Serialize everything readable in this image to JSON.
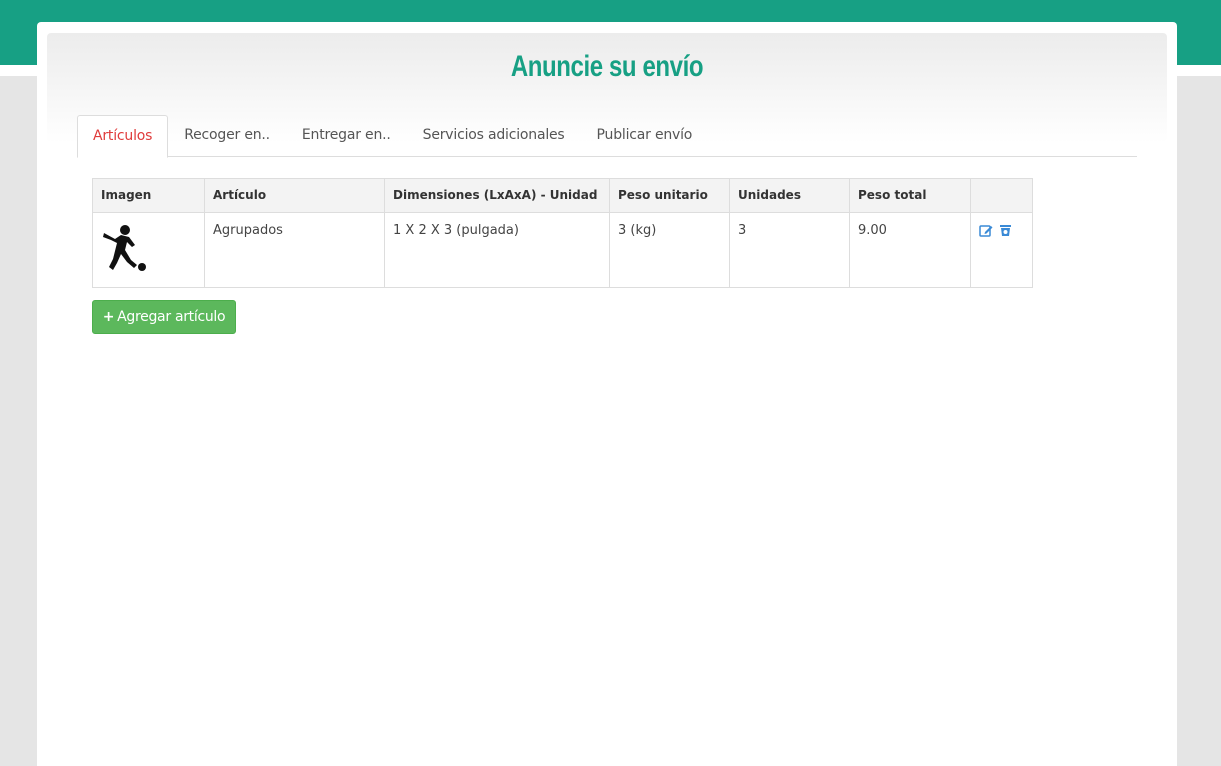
{
  "page": {
    "title": "Anuncie su envío"
  },
  "tabs": [
    {
      "label": "Artículos",
      "active": true
    },
    {
      "label": "Recoger en..",
      "active": false
    },
    {
      "label": "Entregar en..",
      "active": false
    },
    {
      "label": "Servicios adicionales",
      "active": false
    },
    {
      "label": "Publicar envío",
      "active": false
    }
  ],
  "table": {
    "headers": [
      "Imagen",
      "Artículo",
      "Dimensiones (LxAxA) - Unidad",
      "Peso unitario",
      "Unidades",
      "Peso total",
      ""
    ],
    "rows": [
      {
        "image_icon": "soccer-player-icon",
        "article": "Agrupados",
        "dimensions": "1 X 2 X 3 (pulgada)",
        "unit_weight": "3 (kg)",
        "units": "3",
        "total_weight": "9.00",
        "actions": [
          "edit-icon",
          "delete-icon"
        ]
      }
    ]
  },
  "buttons": {
    "add_item_icon": "+",
    "add_item": "Agregar artículo"
  },
  "colors": {
    "brand": "#17a084",
    "active_tab": "#e03b3b",
    "add_button": "#5cb85c",
    "action_icon": "#3a8ad6"
  }
}
